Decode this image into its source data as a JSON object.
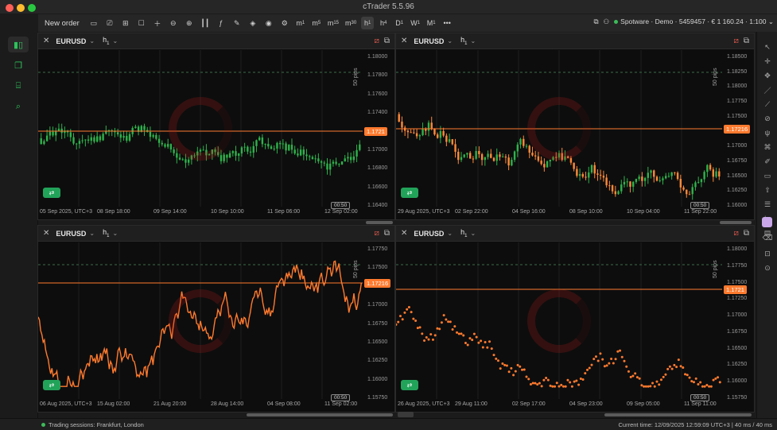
{
  "window": {
    "title": "cTrader 5.5.96"
  },
  "toolbar": {
    "new_order": "New order",
    "timeframes": [
      {
        "base": "m",
        "sub": "1"
      },
      {
        "base": "m",
        "sub": "5"
      },
      {
        "base": "m",
        "sub": "15"
      },
      {
        "base": "m",
        "sub": "30"
      },
      {
        "base": "h",
        "sub": "1",
        "active": true
      },
      {
        "base": "h",
        "sub": "4"
      },
      {
        "base": "D",
        "sub": "1"
      },
      {
        "base": "W",
        "sub": "1"
      },
      {
        "base": "M",
        "sub": "1"
      }
    ],
    "more": "•••",
    "account": "Spotware · Demo · 5459457 · € 1 160.24 · 1:100",
    "account_chevron": "⌄"
  },
  "panes": [
    {
      "symbol": "EURUSD",
      "timeframe_base": "h",
      "timeframe_sub": "1",
      "price_tag": "1.1721",
      "pips_label": "50 pips",
      "countdown": "00:50",
      "y_ticks": [
        "1.18000",
        "1.17800",
        "1.17600",
        "1.17400",
        "1.17200",
        "1.17000",
        "1.16800",
        "1.16600",
        "1.16400"
      ],
      "x_ticks": [
        "05 Sep 2025, UTC+3",
        "08 Sep 18:00",
        "09 Sep 14:00",
        "10 Sep 10:00",
        "11 Sep 06:00",
        "12 Sep 02:00"
      ]
    },
    {
      "symbol": "EURUSD",
      "timeframe_base": "h",
      "timeframe_sub": "1",
      "price_tag": "1.17216",
      "pips_label": "50 pips",
      "countdown": "00:50",
      "y_ticks": [
        "1.18500",
        "1.18250",
        "1.18000",
        "1.17750",
        "1.17500",
        "1.17250",
        "1.17000",
        "1.16750",
        "1.16500",
        "1.16250",
        "1.16000"
      ],
      "x_ticks": [
        "29 Aug 2025, UTC+3",
        "02 Sep 22:00",
        "04 Sep 16:00",
        "08 Sep 10:00",
        "10 Sep 04:00",
        "11 Sep 22:00"
      ]
    },
    {
      "symbol": "EURUSD",
      "timeframe_base": "h",
      "timeframe_sub": "1",
      "price_tag": "1.17216",
      "pips_label": "50 pips",
      "countdown": "00:50",
      "y_ticks": [
        "1.17750",
        "1.17500",
        "1.17250",
        "1.17000",
        "1.16750",
        "1.16500",
        "1.16250",
        "1.16000",
        "1.15750"
      ],
      "x_ticks": [
        "06 Aug 2025, UTC+3",
        "15 Aug 02:00",
        "21 Aug 20:00",
        "28 Aug 14:00",
        "04 Sep 08:00",
        "11 Sep 02:00"
      ]
    },
    {
      "symbol": "EURUSD",
      "timeframe_base": "h",
      "timeframe_sub": "1",
      "price_tag": "1.1721",
      "pips_label": "50 pips",
      "countdown": "00:50",
      "y_ticks": [
        "1.18000",
        "1.17750",
        "1.17500",
        "1.17250",
        "1.17000",
        "1.16750",
        "1.16500",
        "1.16250",
        "1.16000",
        "1.15750"
      ],
      "x_ticks": [
        "26 Aug 2025, UTC+3",
        "29 Aug 11:00",
        "02 Sep 17:00",
        "04 Sep 23:00",
        "09 Sep 05:00",
        "11 Sep 11:00"
      ]
    }
  ],
  "statusbar": {
    "sessions": "Trading sessions: Frankfurt, London",
    "right": "Current time: 12/09/2025 12:59:09 UTC+3 | 40 ms / 40 ms"
  },
  "colors": {
    "accent": "#ff7a2e",
    "bull": "#2fb24c",
    "bear": "#ff8a3a",
    "line": "#ff7a2e"
  }
}
